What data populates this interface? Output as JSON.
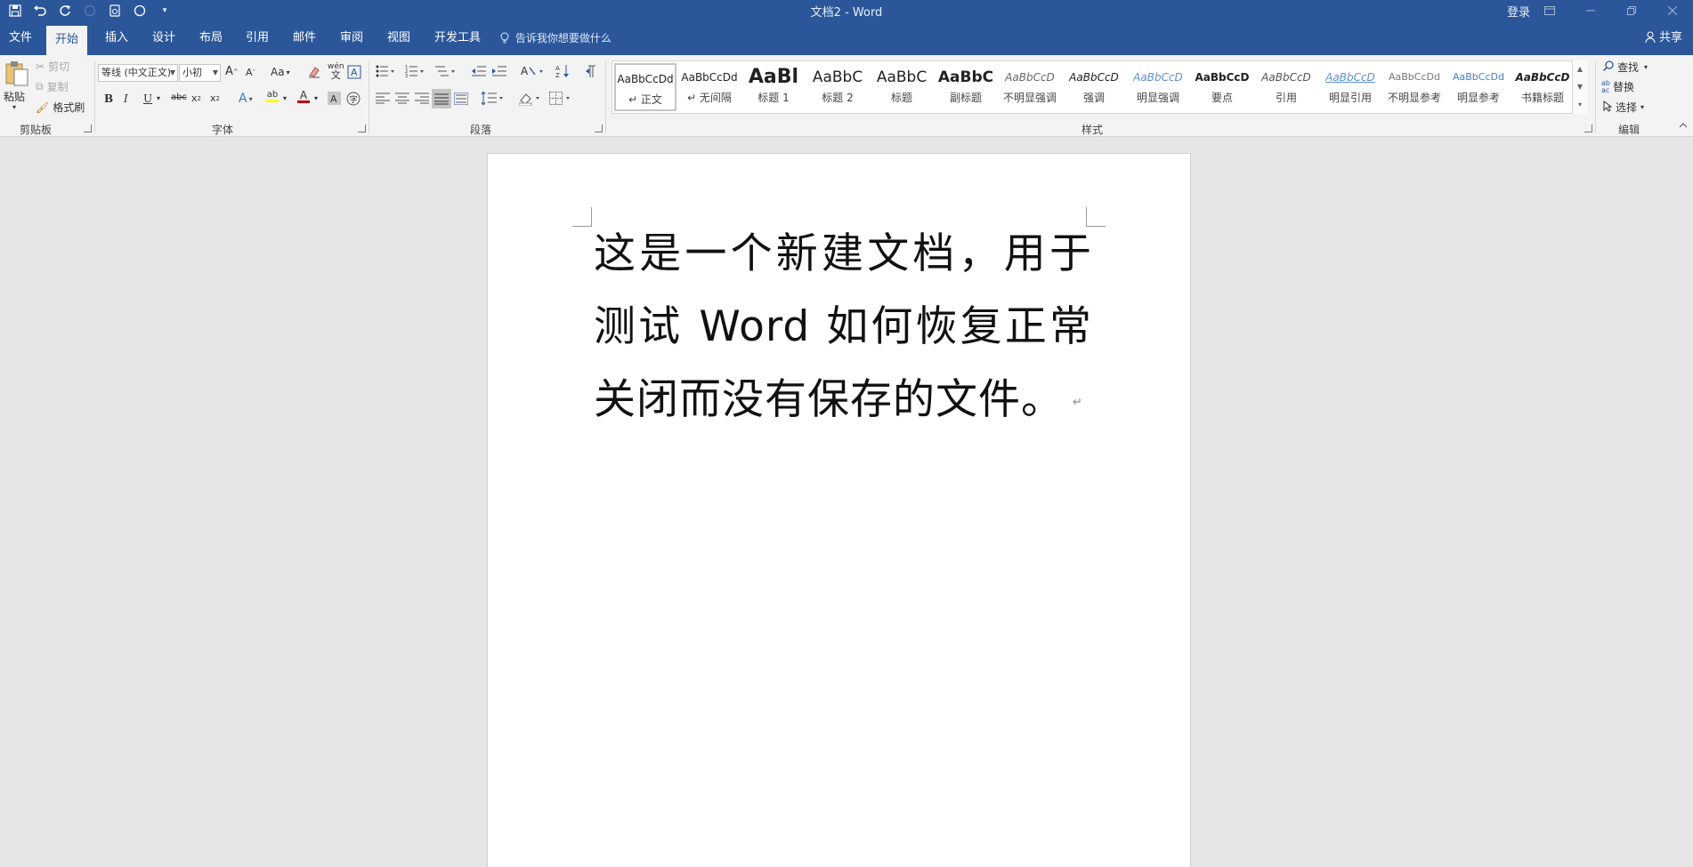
{
  "window": {
    "title": "文档2 - Word",
    "login_label": "登录",
    "share_label": "共享"
  },
  "qat": {
    "icons": [
      "save-icon",
      "undo-icon",
      "redo-icon",
      "circle-icon",
      "touch-mode-icon",
      "circle-outline-icon",
      "customize-qat-icon"
    ]
  },
  "tabs": [
    {
      "label": "文件"
    },
    {
      "label": "开始"
    },
    {
      "label": "插入"
    },
    {
      "label": "设计"
    },
    {
      "label": "布局"
    },
    {
      "label": "引用"
    },
    {
      "label": "邮件"
    },
    {
      "label": "审阅"
    },
    {
      "label": "视图"
    },
    {
      "label": "开发工具"
    }
  ],
  "active_tab": "开始",
  "tell_me": "告诉我你想要做什么",
  "clipboard": {
    "label": "剪贴板",
    "paste": "粘贴",
    "cut": "剪切",
    "copy": "复制",
    "format_painter": "格式刷"
  },
  "font": {
    "label": "字体",
    "font_name": "等线 (中文正文)",
    "font_size": "小初"
  },
  "paragraph": {
    "label": "段落"
  },
  "styles": {
    "label": "样式",
    "items": [
      {
        "sample": "AaBbCcDd",
        "name": "↵ 正文"
      },
      {
        "sample": "AaBbCcDd",
        "name": "↵ 无间隔"
      },
      {
        "sample": "AaBl",
        "name": "标题 1"
      },
      {
        "sample": "AaBbC",
        "name": "标题 2"
      },
      {
        "sample": "AaBbC",
        "name": "标题"
      },
      {
        "sample": "AaBbC",
        "name": "副标题"
      },
      {
        "sample": "AaBbCcD",
        "name": "不明显强调"
      },
      {
        "sample": "AaBbCcD",
        "name": "强调"
      },
      {
        "sample": "AaBbCcD",
        "name": "明显强调"
      },
      {
        "sample": "AaBbCcD",
        "name": "要点"
      },
      {
        "sample": "AaBbCcD",
        "name": "引用"
      },
      {
        "sample": "AaBbCcD",
        "name": "明显引用"
      },
      {
        "sample": "AaBbCcDd",
        "name": "不明显参考"
      },
      {
        "sample": "AaBbCcDd",
        "name": "明显参考"
      },
      {
        "sample": "AaBbCcD",
        "name": "书籍标题"
      }
    ]
  },
  "editing": {
    "label": "编辑",
    "find": "查找",
    "replace": "替换",
    "select": "选择"
  },
  "document": {
    "body": "这是一个新建文档，用于测试 Word 如何恢复正常关闭而没有保存的文件。"
  },
  "colors": {
    "titlebar": "#2b579a",
    "ribbon": "#f3f3f3",
    "workspace": "#e6e6e6"
  }
}
